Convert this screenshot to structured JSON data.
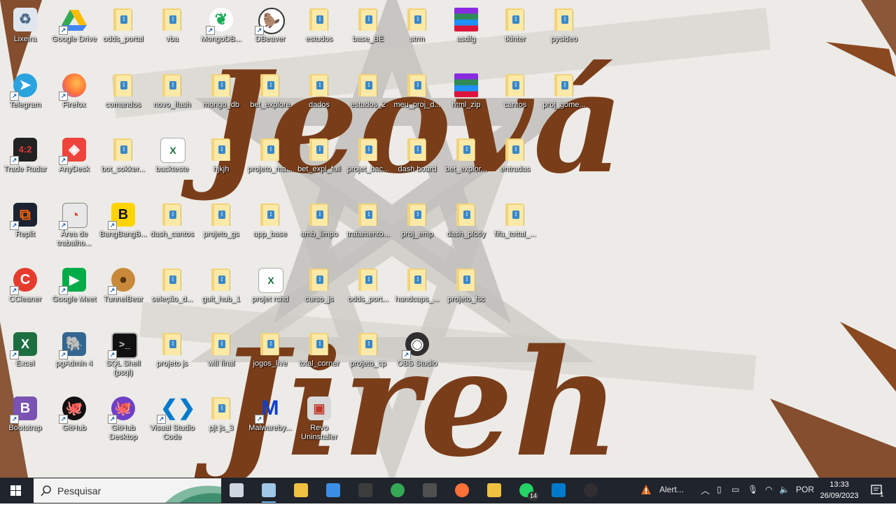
{
  "wallpaper": {
    "line1": "Jeová",
    "line2": "Jireh"
  },
  "desktop": {
    "icons": [
      {
        "label": "Lixeira",
        "icon": "recycle-bin-icon"
      },
      {
        "label": "Google Drive",
        "icon": "google-drive-icon"
      },
      {
        "label": "odds_portal",
        "icon": "folder-icon"
      },
      {
        "label": "vba",
        "icon": "folder-icon"
      },
      {
        "label": "MongoDB...",
        "icon": "mongodb-icon"
      },
      {
        "label": "DBeaver",
        "icon": "dbeaver-icon"
      },
      {
        "label": "estudos",
        "icon": "folder-icon"
      },
      {
        "label": "base_BE",
        "icon": "folder-icon"
      },
      {
        "label": "strm",
        "icon": "folder-icon"
      },
      {
        "label": "asdfg",
        "icon": "winrar-icon"
      },
      {
        "label": "tkinter",
        "icon": "folder-icon"
      },
      {
        "label": "pysideo",
        "icon": "folder-icon"
      },
      {
        "label": "Telegram",
        "icon": "telegram-icon"
      },
      {
        "label": "Firefox",
        "icon": "firefox-icon"
      },
      {
        "label": "comandos",
        "icon": "folder-icon"
      },
      {
        "label": "novo_flash",
        "icon": "folder-icon"
      },
      {
        "label": "mongo_db",
        "icon": "folder-icon"
      },
      {
        "label": "bet_explore",
        "icon": "folder-icon"
      },
      {
        "label": "dados",
        "icon": "folder-icon"
      },
      {
        "label": "estudos_2",
        "icon": "folder-icon"
      },
      {
        "label": "meu_proj_d...",
        "icon": "folder-icon"
      },
      {
        "label": "html_zip",
        "icon": "winrar-icon"
      },
      {
        "label": "cantos",
        "icon": "folder-icon"
      },
      {
        "label": "proj_gome...",
        "icon": "folder-icon"
      },
      {
        "label": "Trade Radar",
        "icon": "trade-radar-icon"
      },
      {
        "label": "AnyDesk",
        "icon": "anydesk-icon"
      },
      {
        "label": "bot_sokker...",
        "icon": "folder-icon"
      },
      {
        "label": "backteste",
        "icon": "excel-file-icon"
      },
      {
        "label": "hjkjh",
        "icon": "folder-icon"
      },
      {
        "label": "projeto_ma...",
        "icon": "folder-icon"
      },
      {
        "label": "bet_expl_full",
        "icon": "folder-icon"
      },
      {
        "label": "projet_bac...",
        "icon": "folder-icon"
      },
      {
        "label": "dash board",
        "icon": "folder-icon"
      },
      {
        "label": "bet_explor...",
        "icon": "folder-icon"
      },
      {
        "label": "entradas",
        "icon": "folder-icon"
      },
      {
        "label": "Replit",
        "icon": "replit-icon"
      },
      {
        "label": "Área de trabalho...",
        "icon": "remote-desktop-icon"
      },
      {
        "label": "BangBangB...",
        "icon": "bangbang-icon"
      },
      {
        "label": "dash_cantos",
        "icon": "folder-icon"
      },
      {
        "label": "projeto_gs",
        "icon": "folder-icon"
      },
      {
        "label": "app_base",
        "icon": "folder-icon"
      },
      {
        "label": "amb_limpo",
        "icon": "folder-icon"
      },
      {
        "label": "tratamento...",
        "icon": "folder-icon"
      },
      {
        "label": "proj_emp",
        "icon": "folder-icon"
      },
      {
        "label": "dash_plotly",
        "icon": "folder-icon"
      },
      {
        "label": "fifa_tottal_...",
        "icon": "folder-icon"
      },
      {
        "label": "CCleaner",
        "icon": "ccleaner-icon"
      },
      {
        "label": "Google Meet",
        "icon": "google-meet-icon"
      },
      {
        "label": "TunnelBear",
        "icon": "tunnelbear-icon"
      },
      {
        "label": "seleção_d...",
        "icon": "folder-icon"
      },
      {
        "label": "guit_hub_1",
        "icon": "folder-icon"
      },
      {
        "label": "projet rchd",
        "icon": "excel-file-icon"
      },
      {
        "label": "curso_js",
        "icon": "folder-icon"
      },
      {
        "label": "odds_port...",
        "icon": "folder-icon"
      },
      {
        "label": "handcaps_...",
        "icon": "folder-icon"
      },
      {
        "label": "projeto_fsc",
        "icon": "folder-icon"
      },
      {
        "label": "Excel",
        "icon": "excel-icon"
      },
      {
        "label": "pgAdmin 4",
        "icon": "pgadmin-icon"
      },
      {
        "label": "SQL Shell (psql)",
        "icon": "terminal-icon"
      },
      {
        "label": "projeto js",
        "icon": "folder-icon"
      },
      {
        "label": "will final",
        "icon": "folder-icon"
      },
      {
        "label": "jogos_live",
        "icon": "folder-icon"
      },
      {
        "label": "total_corner",
        "icon": "folder-icon"
      },
      {
        "label": "projeto_cp",
        "icon": "folder-icon"
      },
      {
        "label": "OBS Studio",
        "icon": "obs-icon"
      },
      {
        "label": "Bootstrap",
        "icon": "bootstrap-icon"
      },
      {
        "label": "GitHub",
        "icon": "github-icon"
      },
      {
        "label": "GitHub Desktop",
        "icon": "github-desktop-icon"
      },
      {
        "label": "Visual Studio Code",
        "icon": "vscode-icon"
      },
      {
        "label": "pjt js_3",
        "icon": "folder-icon"
      },
      {
        "label": "Malwareby...",
        "icon": "malwarebytes-icon"
      },
      {
        "label": "Revo Uninstaller",
        "icon": "revo-icon"
      }
    ]
  },
  "taskbar": {
    "search_placeholder": "Pesquisar",
    "apps": [
      {
        "name": "task-view",
        "color": "#cfd6e0"
      },
      {
        "name": "notepad",
        "color": "#9fc7e6"
      },
      {
        "name": "file-explorer",
        "color": "#f0c040"
      },
      {
        "name": "mail",
        "color": "#3a8ee6"
      },
      {
        "name": "terminal",
        "color": "#3c3c3c"
      },
      {
        "name": "chrome",
        "color": "#34a853"
      },
      {
        "name": "terminal-2",
        "color": "#505050"
      },
      {
        "name": "firefox",
        "color": "#ff7139"
      },
      {
        "name": "python-file",
        "color": "#f0c040"
      },
      {
        "name": "whatsapp",
        "color": "#25d366"
      },
      {
        "name": "vscode",
        "color": "#007acc"
      },
      {
        "name": "obs",
        "color": "#302e31"
      }
    ],
    "whatsapp_badge": "14",
    "alert_label": "Alert...",
    "language": "POR",
    "time": "13:33",
    "date": "26/09/2023",
    "notifications": "1"
  }
}
